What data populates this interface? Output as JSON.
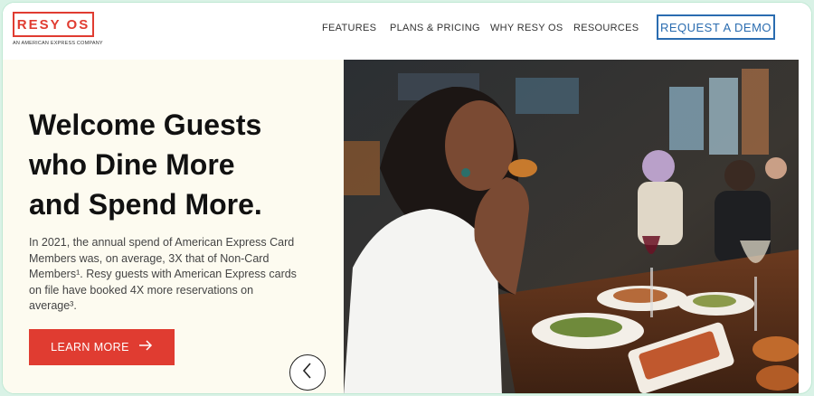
{
  "brand": {
    "logo": "RESY OS",
    "tagline": "AN AMERICAN EXPRESS COMPANY"
  },
  "nav": {
    "items": [
      "FEATURES",
      "PLANS & PRICING",
      "WHY RESY OS",
      "RESOURCES"
    ],
    "cta": "REQUEST A DEMO"
  },
  "hero": {
    "headline_lines": [
      "Welcome Guests",
      "who Dine More",
      "and Spend More."
    ],
    "body": "In 2021, the annual spend of American Express Card Members was, on average, 3X that of Non-Card Members¹. Resy guests with American Express cards on file have booked 4X more reservations on average³.",
    "cta": "LEARN MORE",
    "cta_icon": "arrow-right-icon",
    "prev_icon": "chevron-left-icon"
  },
  "colors": {
    "brand_red": "#e03c31",
    "link_blue": "#2a6cb0",
    "hero_bg": "#fdfbf0",
    "frame_green": "#d9f2e6"
  }
}
